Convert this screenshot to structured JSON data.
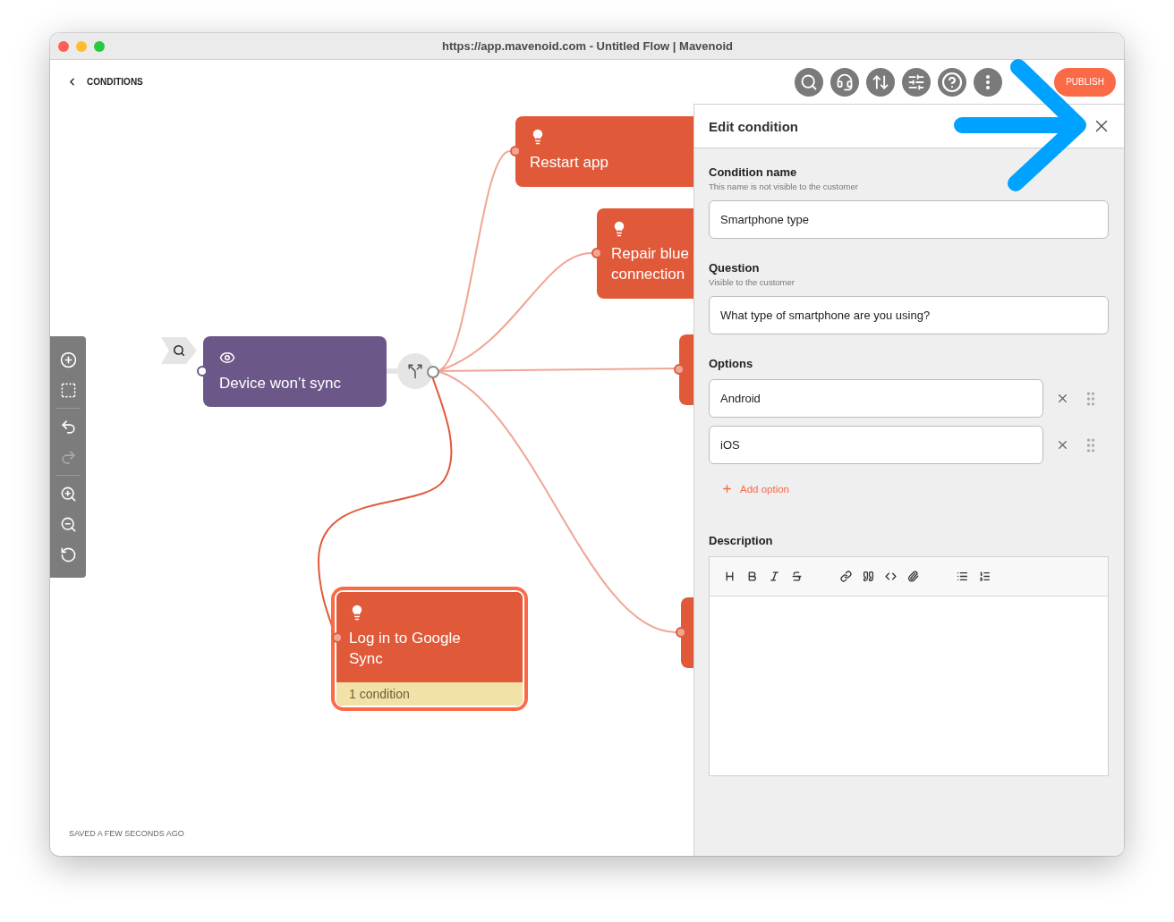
{
  "window": {
    "title": "https://app.mavenoid.com - Untitled Flow | Mavenoid"
  },
  "breadcrumb": {
    "label": "CONDITIONS"
  },
  "toolbar": [
    {
      "kind": "search"
    },
    {
      "kind": "headset"
    },
    {
      "kind": "sort"
    },
    {
      "kind": "sliders"
    },
    {
      "kind": "help"
    },
    {
      "kind": "more"
    }
  ],
  "publish_button": {
    "label": "PUBLISH"
  },
  "canvas_tools": [
    {
      "tools": [
        {
          "kind": "add",
          "disabled": false
        },
        {
          "kind": "select",
          "disabled": false
        }
      ]
    },
    {
      "tools": [
        {
          "kind": "undo",
          "disabled": false
        },
        {
          "kind": "redo",
          "disabled": true
        }
      ]
    },
    {
      "tools": [
        {
          "kind": "zoom_in",
          "disabled": false
        },
        {
          "kind": "zoom_out",
          "disabled": false
        },
        {
          "kind": "zoom_reset",
          "disabled": false
        }
      ]
    }
  ],
  "nodes": [
    {
      "kind": "start",
      "title": "Device won’t sync",
      "selected": false
    },
    {
      "kind": "solution",
      "title": "Restart app",
      "selected": false
    },
    {
      "kind": "solution",
      "title": "Repair blue connection",
      "selected": false
    },
    {
      "kind": "stub",
      "selected": false
    },
    {
      "kind": "stub",
      "selected": false
    },
    {
      "kind": "solution",
      "title": "Log in to Google Sync",
      "footer": "1 condition",
      "selected": true
    }
  ],
  "status": "SAVED A FEW SECONDS AGO",
  "panel": {
    "title": "Edit condition",
    "name_field": {
      "label": "Condition name",
      "hint": "This name is not visible to the customer",
      "value": "Smartphone type"
    },
    "question_field": {
      "label": "Question",
      "hint": "Visible to the customer",
      "value": "What type of smartphone are you using?"
    },
    "options": {
      "label": "Options",
      "items": [
        "Android",
        "iOS"
      ],
      "add_label": "Add option"
    },
    "description": {
      "label": "Description",
      "tools": [
        {
          "kind": "heading"
        },
        {
          "kind": "bold"
        },
        {
          "kind": "italic"
        },
        {
          "kind": "strike"
        },
        {
          "kind": "gap"
        },
        {
          "kind": "link"
        },
        {
          "kind": "quote"
        },
        {
          "kind": "code"
        },
        {
          "kind": "attach"
        },
        {
          "kind": "gap"
        },
        {
          "kind": "bullets"
        },
        {
          "kind": "numbers"
        }
      ]
    }
  }
}
